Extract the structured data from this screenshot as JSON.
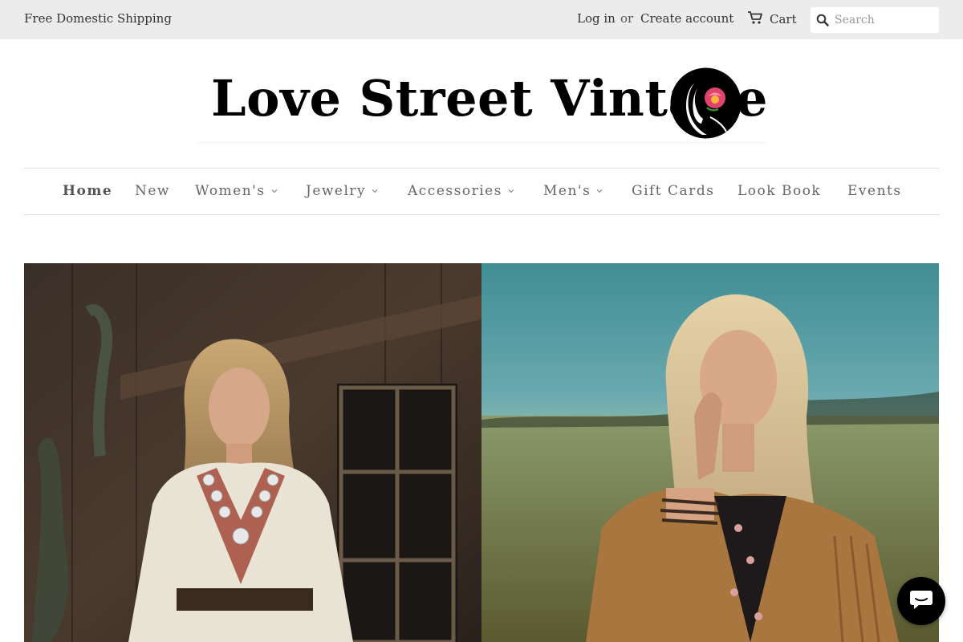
{
  "topbar": {
    "promo": "Free Domestic Shipping",
    "login": "Log in",
    "or": "or",
    "create_account": "Create account",
    "cart_label": "Cart",
    "search_placeholder": "Search"
  },
  "logo": {
    "text": "Love Street Vintage"
  },
  "nav": {
    "items": [
      {
        "label": "Home",
        "active": true
      },
      {
        "label": "New"
      },
      {
        "label": "Women's",
        "dropdown": true
      },
      {
        "label": "Jewelry",
        "dropdown": true
      },
      {
        "label": "Accessories",
        "dropdown": true
      },
      {
        "label": "Men's",
        "dropdown": true
      },
      {
        "label": "Gift Cards"
      },
      {
        "label": "Look Book"
      },
      {
        "label": "Events"
      }
    ]
  },
  "icons": {
    "cart": "cart-icon",
    "search": "search-icon",
    "chat": "chat-icon",
    "dropdown": "chevron-down-icon"
  },
  "colors": {
    "topbar_bg": "#ececec",
    "nav_text": "#666666",
    "chat_bg": "#000000"
  }
}
